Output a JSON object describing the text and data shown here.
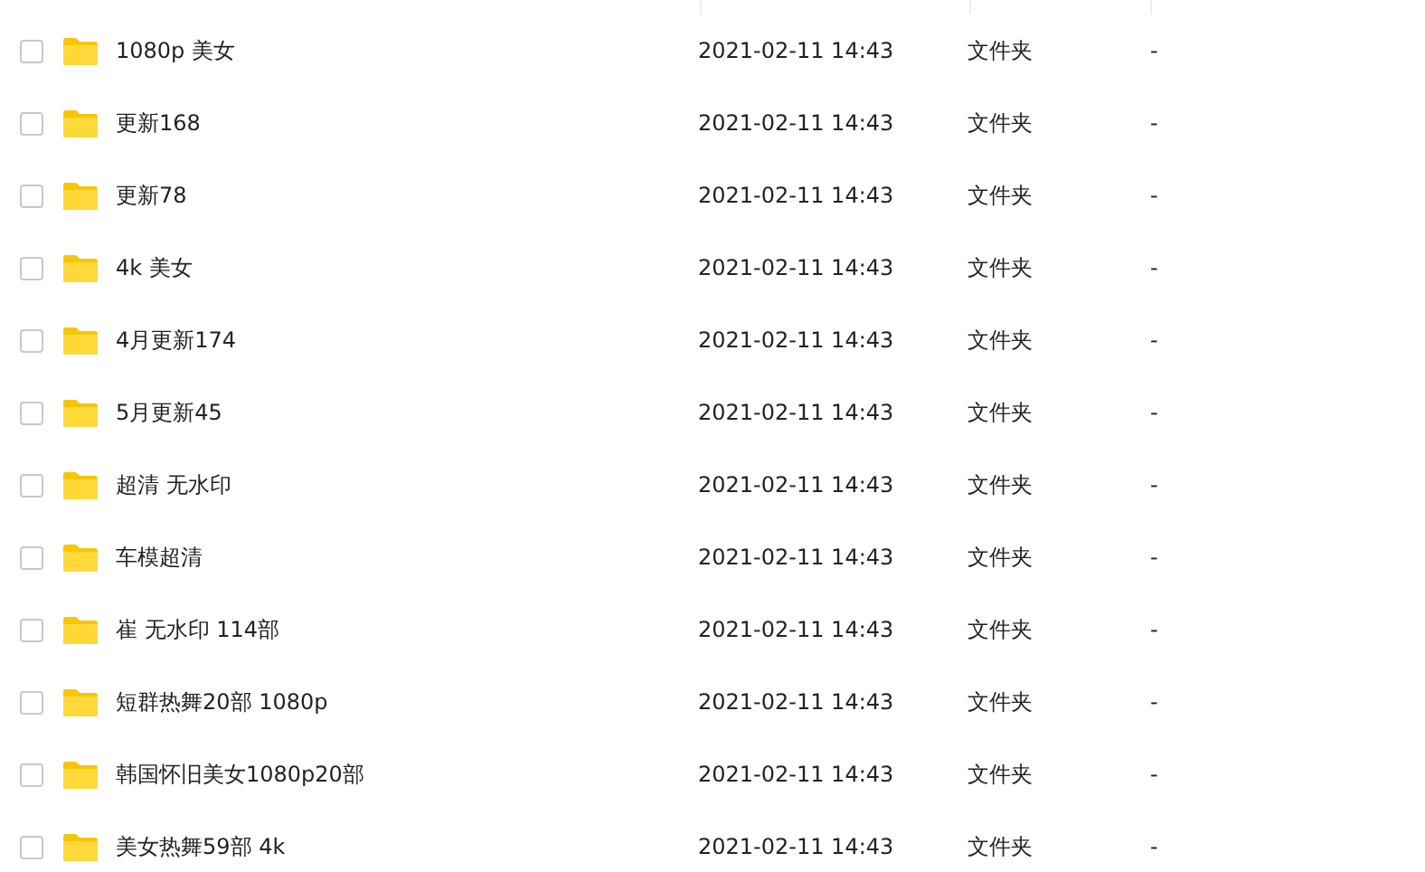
{
  "files": [
    {
      "name": "1080p 美女",
      "modified": "2021-02-11 14:43",
      "type": "文件夹",
      "size": "-",
      "checked": false
    },
    {
      "name": "更新168",
      "modified": "2021-02-11 14:43",
      "type": "文件夹",
      "size": "-",
      "checked": false
    },
    {
      "name": "更新78",
      "modified": "2021-02-11 14:43",
      "type": "文件夹",
      "size": "-",
      "checked": false
    },
    {
      "name": "4k 美女",
      "modified": "2021-02-11 14:43",
      "type": "文件夹",
      "size": "-",
      "checked": false
    },
    {
      "name": "4月更新174",
      "modified": "2021-02-11 14:43",
      "type": "文件夹",
      "size": "-",
      "checked": false
    },
    {
      "name": "5月更新45",
      "modified": "2021-02-11 14:43",
      "type": "文件夹",
      "size": "-",
      "checked": false
    },
    {
      "name": "超清 无水印",
      "modified": "2021-02-11 14:43",
      "type": "文件夹",
      "size": "-",
      "checked": false
    },
    {
      "name": "车模超清",
      "modified": "2021-02-11 14:43",
      "type": "文件夹",
      "size": "-",
      "checked": false
    },
    {
      "name": "崔 无水印 114部",
      "modified": "2021-02-11 14:43",
      "type": "文件夹",
      "size": "-",
      "checked": false
    },
    {
      "name": "短群热舞20部 1080p",
      "modified": "2021-02-11 14:43",
      "type": "文件夹",
      "size": "-",
      "checked": false
    },
    {
      "name": "韩国怀旧美女1080p20部",
      "modified": "2021-02-11 14:43",
      "type": "文件夹",
      "size": "-",
      "checked": false
    },
    {
      "name": "美女热舞59部 4k",
      "modified": "2021-02-11 14:43",
      "type": "文件夹",
      "size": "-",
      "checked": false
    }
  ]
}
